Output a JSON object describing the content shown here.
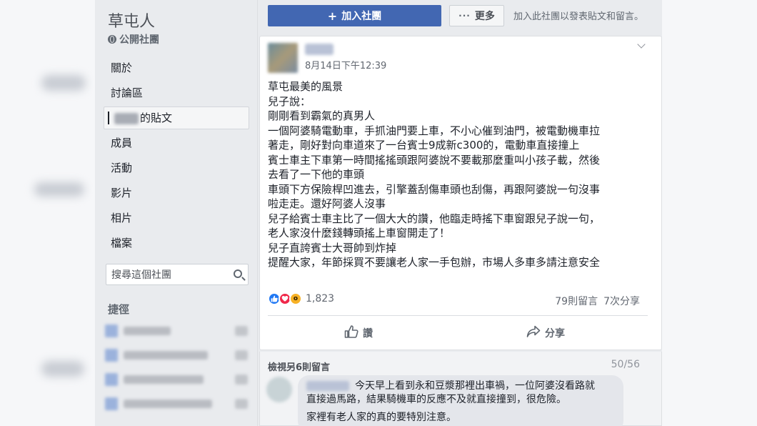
{
  "sidebar": {
    "group_name": "草屯人",
    "group_type": "公開社團",
    "nav": [
      {
        "label": "關於"
      },
      {
        "label": "討論區"
      },
      {
        "label": "的貼文"
      },
      {
        "label": "成員"
      },
      {
        "label": "活動"
      },
      {
        "label": "影片"
      },
      {
        "label": "相片"
      },
      {
        "label": "檔案"
      }
    ],
    "search_placeholder": "搜尋這個社團",
    "shortcuts_title": "捷徑"
  },
  "header": {
    "join_label": "加入社團",
    "more_label": "更多",
    "join_hint": "加入此社團以發表貼文和留言。"
  },
  "post": {
    "timestamp": "8月14日下午12:39",
    "lines": [
      "草屯最美的風景",
      "兒子說：",
      "剛剛看到霸氣的真男人",
      "一個阿婆騎電動車，手抓油門要上車，不小心催到油門，被電動機車拉",
      "著走，剛好對向車道來了一台賓士9成新c300的，電動車直接撞上",
      "賓士車主下車第一時間搖搖頭跟阿婆說不要載那麼重叫小孩子載，然後",
      "去看了一下他的車頭",
      "車頭下方保險桿凹進去，引擎蓋刮傷車頭也刮傷，再跟阿婆說一句沒事",
      "啦走走。還好阿婆人沒事",
      "兒子給賓士車主比了一個大大的讚，他臨走時搖下車窗跟兒子說一句，",
      "老人家沒什麼錢轉頭搖上車窗開走了！",
      "兒子直誇賓士大哥帥到炸掉",
      "提醒大家，年節採買不要讓老人家一手包辦，市場人多車多請注意安全"
    ],
    "reaction_count": "1,823",
    "comments_count": "79則留言",
    "shares_count": "7次分享",
    "like_label": "讚",
    "share_label": "分享"
  },
  "comments": {
    "view_more": "檢視另6則留言",
    "count": "50/56",
    "text_line1": "今天早上看到永和豆漿那裡出車禍，一位阿婆沒看路就",
    "text_line2": "直接過馬路，結果騎機車的反應不及就直接撞到，很危險。",
    "text_line3": "家裡有老人家的真的要特別注意。"
  },
  "colors": {
    "accent": "#4267b2",
    "like": "#2078f4",
    "love": "#f0284a",
    "wow": "#f7b125"
  }
}
